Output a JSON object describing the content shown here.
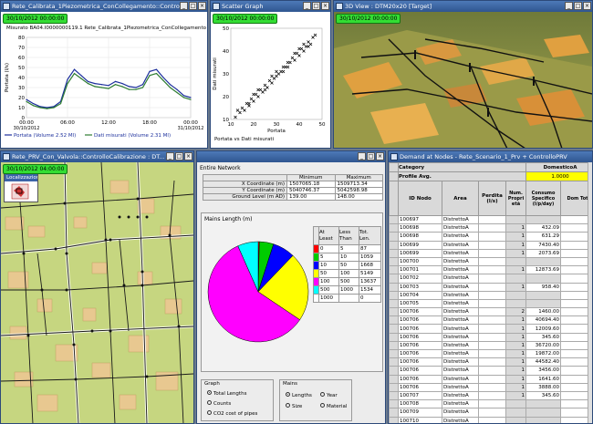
{
  "windows": {
    "calibration": {
      "title": "Rete_Calibrata_1Piezometrica_ConCollegamento::Controllo...",
      "date": "30/10/2012 00:00:00",
      "subtitle": "Misurato BA04.I0000000119.1 Rete_Calibrata_1Piezometrica_ConCollegamento"
    },
    "scatter": {
      "title": "Scatter Graph",
      "date": "30/10/2012 00:00:00"
    },
    "view3d": {
      "title": "3D View : DTM20x20 [Target]",
      "date": "30/10/2012 00:00:00"
    },
    "map": {
      "title": "Rete_PRV_Con_Valvola::ControlloCalibrazione : DT...",
      "date": "30/10/2012 04:00:00",
      "panel_title": "Localizzazione"
    },
    "demand": {
      "title": "Demand at Nodes - Rete_Scenario_1_Prv + ControlloPRV"
    }
  },
  "chart_data": [
    {
      "type": "line",
      "title": "",
      "ylabel": "Portata (l/s)",
      "ylim": [
        0,
        80
      ],
      "y_ticks": [
        "0",
        "10",
        "20",
        "30",
        "40",
        "50",
        "60",
        "70",
        "80"
      ],
      "x_ticks": [
        "00:00",
        "06:00",
        "12:00",
        "18:00",
        "00:00"
      ],
      "x_tick_dates": [
        "30/10/2012",
        "",
        "",
        "",
        "31/10/2012"
      ],
      "x_hours": [
        0,
        1,
        2,
        3,
        4,
        5,
        6,
        7,
        8,
        9,
        10,
        11,
        12,
        13,
        14,
        15,
        16,
        17,
        18,
        19,
        20,
        21,
        22,
        23,
        24
      ],
      "series": [
        {
          "name": "Portata (Volume 2.52 Ml)",
          "color": "#1c2f9c",
          "values": [
            18,
            14,
            11,
            10,
            11,
            16,
            38,
            48,
            42,
            36,
            34,
            33,
            32,
            36,
            34,
            31,
            30,
            33,
            46,
            48,
            40,
            33,
            28,
            22,
            20
          ]
        },
        {
          "name": "Dati misurati (Volume 2.31 Ml)",
          "color": "#2e7d32",
          "values": [
            16,
            12,
            10,
            9,
            10,
            14,
            34,
            44,
            39,
            34,
            31,
            30,
            29,
            33,
            31,
            28,
            28,
            30,
            42,
            44,
            37,
            30,
            25,
            20,
            18
          ]
        }
      ]
    },
    {
      "type": "scatter",
      "xlabel": "Portata",
      "ylabel": "Dati misurati",
      "xlim": [
        10,
        50
      ],
      "ylim": [
        10,
        50
      ],
      "x_ticks": [
        "10",
        "20",
        "30",
        "40",
        "50"
      ],
      "y_ticks": [
        "10",
        "20",
        "30",
        "40",
        "50"
      ],
      "legend": "Portata vs Dati misurati",
      "points": [
        [
          12,
          11
        ],
        [
          13,
          14
        ],
        [
          14,
          13
        ],
        [
          15,
          15
        ],
        [
          16,
          14
        ],
        [
          17,
          17
        ],
        [
          18,
          16
        ],
        [
          19,
          19
        ],
        [
          20,
          18
        ],
        [
          21,
          21
        ],
        [
          22,
          20
        ],
        [
          23,
          23
        ],
        [
          24,
          22
        ],
        [
          25,
          25
        ],
        [
          26,
          24
        ],
        [
          27,
          27
        ],
        [
          28,
          26
        ],
        [
          29,
          28
        ],
        [
          30,
          29
        ],
        [
          31,
          30
        ],
        [
          32,
          31
        ],
        [
          33,
          33
        ],
        [
          34,
          33
        ],
        [
          35,
          35
        ],
        [
          36,
          35
        ],
        [
          37,
          37
        ],
        [
          38,
          36
        ],
        [
          39,
          39
        ],
        [
          40,
          38
        ],
        [
          41,
          41
        ],
        [
          42,
          40
        ],
        [
          43,
          42
        ],
        [
          44,
          44
        ],
        [
          45,
          43
        ],
        [
          46,
          46
        ],
        [
          47,
          47
        ],
        [
          20,
          21
        ],
        [
          25,
          23
        ],
        [
          30,
          31
        ],
        [
          35,
          33
        ],
        [
          40,
          41
        ],
        [
          44,
          42
        ],
        [
          33,
          31
        ],
        [
          28,
          29
        ],
        [
          22,
          23
        ],
        [
          18,
          17
        ],
        [
          38,
          39
        ],
        [
          42,
          43
        ]
      ]
    },
    {
      "type": "pie",
      "title": "Mains Length (m)",
      "slices": [
        {
          "at_least": "0",
          "less_than": "5",
          "total": "87",
          "color": "#ff0000"
        },
        {
          "at_least": "5",
          "less_than": "10",
          "total": "1059",
          "color": "#00cc00"
        },
        {
          "at_least": "10",
          "less_than": "50",
          "total": "1668",
          "color": "#0000ff"
        },
        {
          "at_least": "50",
          "less_than": "100",
          "total": "5149",
          "color": "#ffff00"
        },
        {
          "at_least": "100",
          "less_than": "500",
          "total": "13637",
          "color": "#ff00ff"
        },
        {
          "at_least": "500",
          "less_than": "1000",
          "total": "1534",
          "color": "#00ffff"
        },
        {
          "at_least": "1000",
          "less_than": "",
          "total": "0",
          "color": "#ffffff"
        }
      ],
      "headers": [
        "At Least",
        "Less Than",
        "Tot. Len."
      ]
    }
  ],
  "stats": {
    "group": "Entire Network",
    "cols": [
      "Minimum",
      "Maximum"
    ],
    "rows": [
      {
        "label": "X Coordinate (m)",
        "min": "1507065.18",
        "max": "1509713.34"
      },
      {
        "label": "Y Coordinate (m)",
        "min": "5040746.37",
        "max": "5042598.98"
      },
      {
        "label": "Ground Level (m AD)",
        "min": "139.00",
        "max": "148.00"
      }
    ]
  },
  "options": {
    "graph_label": "Graph",
    "graph_options": [
      "Total Lengths",
      "Counts",
      "CO2 cost of pipes"
    ],
    "mains_label": "Mains",
    "mains_options": [
      "Lengths",
      "Year",
      "Size",
      "Material"
    ]
  },
  "demand": {
    "category_label": "Category",
    "category_value": "DomesticoA",
    "profile_label": "Profile Avg.",
    "profile_value": "1.0000",
    "headers": [
      "ID Nodo",
      "Area",
      "Perdita (l/s)",
      "Num. Propri età",
      "Consumo Specifico (l/p/day)",
      "Dom Tot"
    ],
    "rows": [
      [
        "100697",
        "DistrettoA",
        "",
        "",
        ""
      ],
      [
        "100698",
        "DistrettoA",
        "",
        "1",
        "432.09"
      ],
      [
        "100698",
        "DistrettoA",
        "",
        "1",
        "631.29"
      ],
      [
        "100699",
        "DistrettoA",
        "",
        "1",
        "7430.40"
      ],
      [
        "100699",
        "DistrettoA",
        "",
        "1",
        "2073.69"
      ],
      [
        "100700",
        "DistrettoA",
        "",
        "",
        ""
      ],
      [
        "100701",
        "DistrettoA",
        "",
        "1",
        "12873.69"
      ],
      [
        "100702",
        "DistrettoA",
        "",
        "",
        ""
      ],
      [
        "100703",
        "DistrettoA",
        "",
        "1",
        "958.40"
      ],
      [
        "100704",
        "DistrettoA",
        "",
        "",
        ""
      ],
      [
        "100705",
        "DistrettoA",
        "",
        "",
        ""
      ],
      [
        "100706",
        "DistrettoA",
        "",
        "2",
        "1460.00"
      ],
      [
        "100706",
        "DistrettoA",
        "",
        "1",
        "40694.40"
      ],
      [
        "100706",
        "DistrettoA",
        "",
        "1",
        "12009.60"
      ],
      [
        "100706",
        "DistrettoA",
        "",
        "1",
        "345.60"
      ],
      [
        "100706",
        "DistrettoA",
        "",
        "1",
        "36720.00"
      ],
      [
        "100706",
        "DistrettoA",
        "",
        "1",
        "19872.00"
      ],
      [
        "100706",
        "DistrettoA",
        "",
        "1",
        "44582.40"
      ],
      [
        "100706",
        "DistrettoA",
        "",
        "1",
        "3456.00"
      ],
      [
        "100706",
        "DistrettoA",
        "",
        "1",
        "1641.60"
      ],
      [
        "100706",
        "DistrettoA",
        "",
        "1",
        "3888.00"
      ],
      [
        "100707",
        "DistrettoA",
        "",
        "1",
        "345.60"
      ],
      [
        "100708",
        "DistrettoA",
        "",
        "",
        ""
      ],
      [
        "100709",
        "DistrettoA",
        "",
        "",
        ""
      ],
      [
        "100710",
        "DistrettoA",
        "",
        "",
        ""
      ],
      [
        "100711",
        "DistrettoA",
        "",
        "",
        ""
      ]
    ]
  }
}
